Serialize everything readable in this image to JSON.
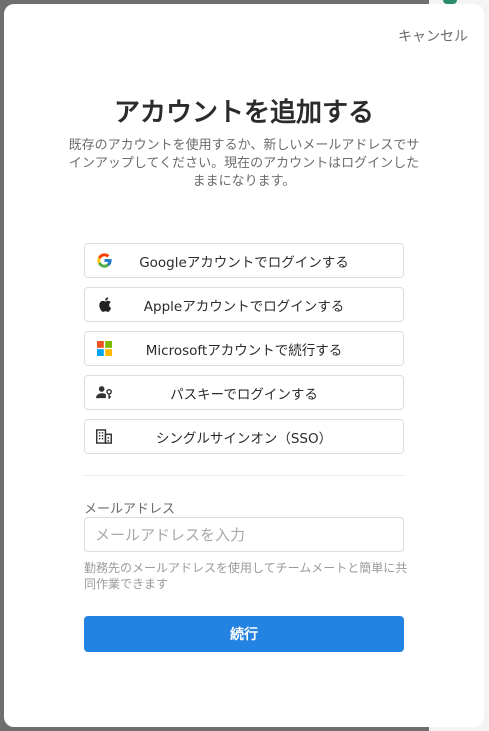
{
  "dialog": {
    "cancel_label": "キャンセル",
    "title": "アカウントを追加する",
    "subtitle": "既存のアカウントを使用するか、新しいメールアドレスでサインアップしてください。現在のアカウントはログインしたままになります。"
  },
  "providers": [
    {
      "brand": "Google",
      "label": "Googleアカウントでログインする",
      "icon": "google-icon"
    },
    {
      "brand": "Apple",
      "label": "Appleアカウントでログインする",
      "icon": "apple-icon"
    },
    {
      "brand": "Microsoft",
      "label": "Microsoftアカウントで続行する",
      "icon": "microsoft-icon"
    },
    {
      "brand": "",
      "label": "パスキーでログインする",
      "icon": "passkey-icon"
    },
    {
      "brand": "",
      "label": "シングルサインオン（SSO）",
      "icon": "building-icon"
    }
  ],
  "email": {
    "label": "メールアドレス",
    "placeholder": "メールアドレスを入力",
    "value": "",
    "hint": "勤務先のメールアドレスを使用してチームメートと簡単に共同作業できます"
  },
  "continue_label": "続行",
  "colors": {
    "accent": "#2383e2",
    "overlay": "#6f6f6f",
    "text": "#2b2b2b",
    "muted": "#6b6b6b"
  }
}
